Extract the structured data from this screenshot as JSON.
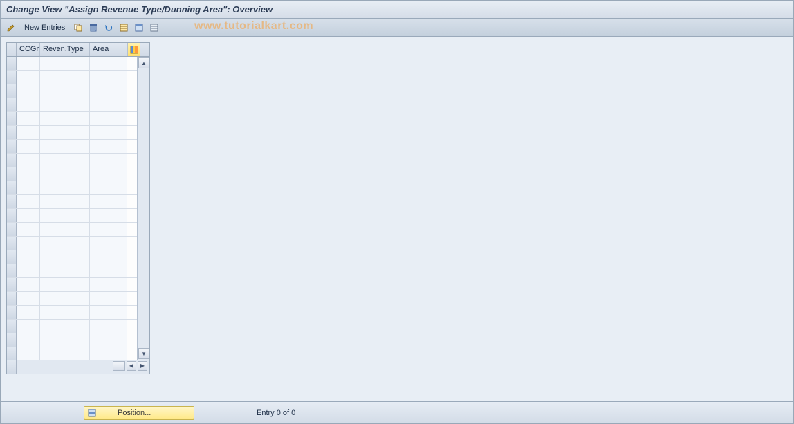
{
  "header": {
    "title": "Change View \"Assign Revenue Type/Dunning Area\": Overview"
  },
  "toolbar": {
    "new_entries_label": "New Entries"
  },
  "watermark": "www.tutorialkart.com",
  "table": {
    "columns": [
      "CCGr",
      "Reven.Type",
      "Area"
    ],
    "row_count": 22
  },
  "footer": {
    "position_label": "Position...",
    "entry_label": "Entry 0 of 0"
  }
}
